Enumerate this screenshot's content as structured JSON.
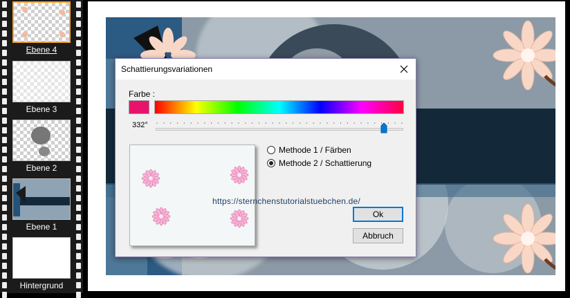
{
  "layers_panel": {
    "layers": [
      {
        "name": "Ebene 4",
        "selected": true,
        "kind": "flowers"
      },
      {
        "name": "Ebene 3",
        "selected": false,
        "kind": "blur"
      },
      {
        "name": "Ebene 2",
        "selected": false,
        "kind": "circles"
      },
      {
        "name": "Ebene 1",
        "selected": false,
        "kind": "band"
      },
      {
        "name": "Hintergrund",
        "selected": false,
        "kind": "white"
      }
    ]
  },
  "dialog": {
    "title": "Schattierungsvariationen",
    "color_label": "Farbe :",
    "swatch_color": "#e8136b",
    "hue_degrees": "332°",
    "hue_value": 332,
    "hue_max": 360,
    "method1_label": "Methode 1 / Färben",
    "method2_label": "Methode 2 / Schattierung",
    "selected_method": 2,
    "ok_label": "Ok",
    "cancel_label": "Abbruch"
  },
  "watermark": "https://sternchenstutorialstuebchen.de/",
  "colors": {
    "accent_selection": "#f3a531",
    "artwork_background": "#8b9aa6",
    "dark_band": "#13293a",
    "flower_petal": "#f9d7c6"
  }
}
